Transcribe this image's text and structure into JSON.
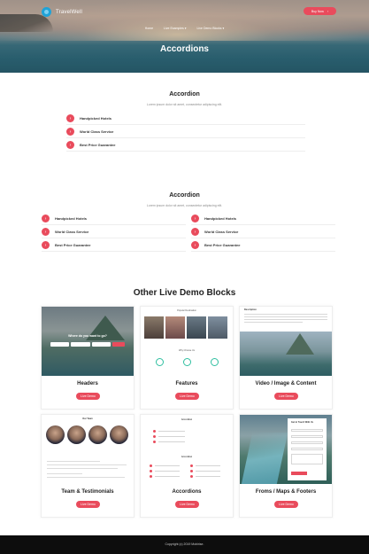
{
  "header": {
    "brand": "TravelWell",
    "buy_label": "Buy Now",
    "nav": [
      "Home",
      "Live Examples ▾",
      "Live Demo Blocks ▾"
    ],
    "page_title": "Accordions"
  },
  "accordion_one": {
    "title": "Accordion",
    "subtitle": "Lorem ipsum dolor sit amet, consectetur adipiscing elit.",
    "items": [
      "Handpicked Hotels",
      "World Class Service",
      "Best Price Guarantee"
    ]
  },
  "accordion_two": {
    "title": "Accordion",
    "subtitle": "Lorem ipsum dolor sit amet, consectetur adipiscing elit.",
    "left_items": [
      "Handpicked Hotels",
      "World Class Service",
      "Best Price Guarantee"
    ],
    "right_items": [
      "Handpicked Hotels",
      "World Class Service",
      "Best Price Guarantee"
    ]
  },
  "demo": {
    "title": "Other Live Demo Blocks",
    "button_label": "Live Demo",
    "cards": [
      {
        "name": "Headers"
      },
      {
        "name": "Features"
      },
      {
        "name": "Video / Image & Content"
      },
      {
        "name": "Team & Testimonials"
      },
      {
        "name": "Accordions"
      },
      {
        "name": "Froms / Maps & Footers"
      }
    ],
    "thumb_text": {
      "headers_heading": "Where do you want to go?",
      "features_heading": "Popular Destination",
      "features_sub": "Why Choose Us",
      "video_heading": "Description",
      "team_heading": "Our Team",
      "acc_heading": "Accordion",
      "forms_heading": "Get in Touch With Us"
    }
  },
  "footer": {
    "text": "Copyright (c) 2019 Mobirise."
  },
  "colors": {
    "accent": "#e94b5c",
    "footer": "#0d0d0d"
  }
}
